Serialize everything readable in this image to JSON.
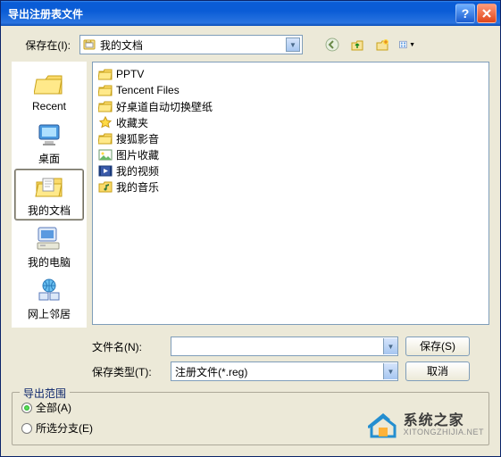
{
  "window": {
    "title": "导出注册表文件"
  },
  "toolbar": {
    "save_in_label": "保存在(I):",
    "location_text": "我的文档"
  },
  "places": [
    {
      "id": "recent",
      "label": "Recent",
      "icon": "folder-recent"
    },
    {
      "id": "desktop",
      "label": "桌面",
      "icon": "desktop"
    },
    {
      "id": "mydocs",
      "label": "我的文档",
      "icon": "mydocs",
      "selected": true
    },
    {
      "id": "mycomp",
      "label": "我的电脑",
      "icon": "computer"
    },
    {
      "id": "network",
      "label": "网上邻居",
      "icon": "network"
    }
  ],
  "files": [
    {
      "name": "PPTV",
      "icon": "folder"
    },
    {
      "name": "Tencent Files",
      "icon": "folder"
    },
    {
      "name": "好桌道自动切换壁纸",
      "icon": "folder"
    },
    {
      "name": "收藏夹",
      "icon": "star"
    },
    {
      "name": "搜狐影音",
      "icon": "folder"
    },
    {
      "name": "图片收藏",
      "icon": "pictures"
    },
    {
      "name": "我的视频",
      "icon": "video"
    },
    {
      "name": "我的音乐",
      "icon": "music"
    }
  ],
  "fields": {
    "filename_label": "文件名(N):",
    "filename_value": "",
    "filetype_label": "保存类型(T):",
    "filetype_value": "注册文件(*.reg)"
  },
  "buttons": {
    "save": "保存(S)",
    "cancel": "取消"
  },
  "export_range": {
    "legend": "导出范围",
    "all": "全部(A)",
    "branch": "所选分支(E)",
    "selected": "all"
  },
  "watermark": {
    "name": "系统之家",
    "url": "XITONGZHIJIA.NET"
  }
}
